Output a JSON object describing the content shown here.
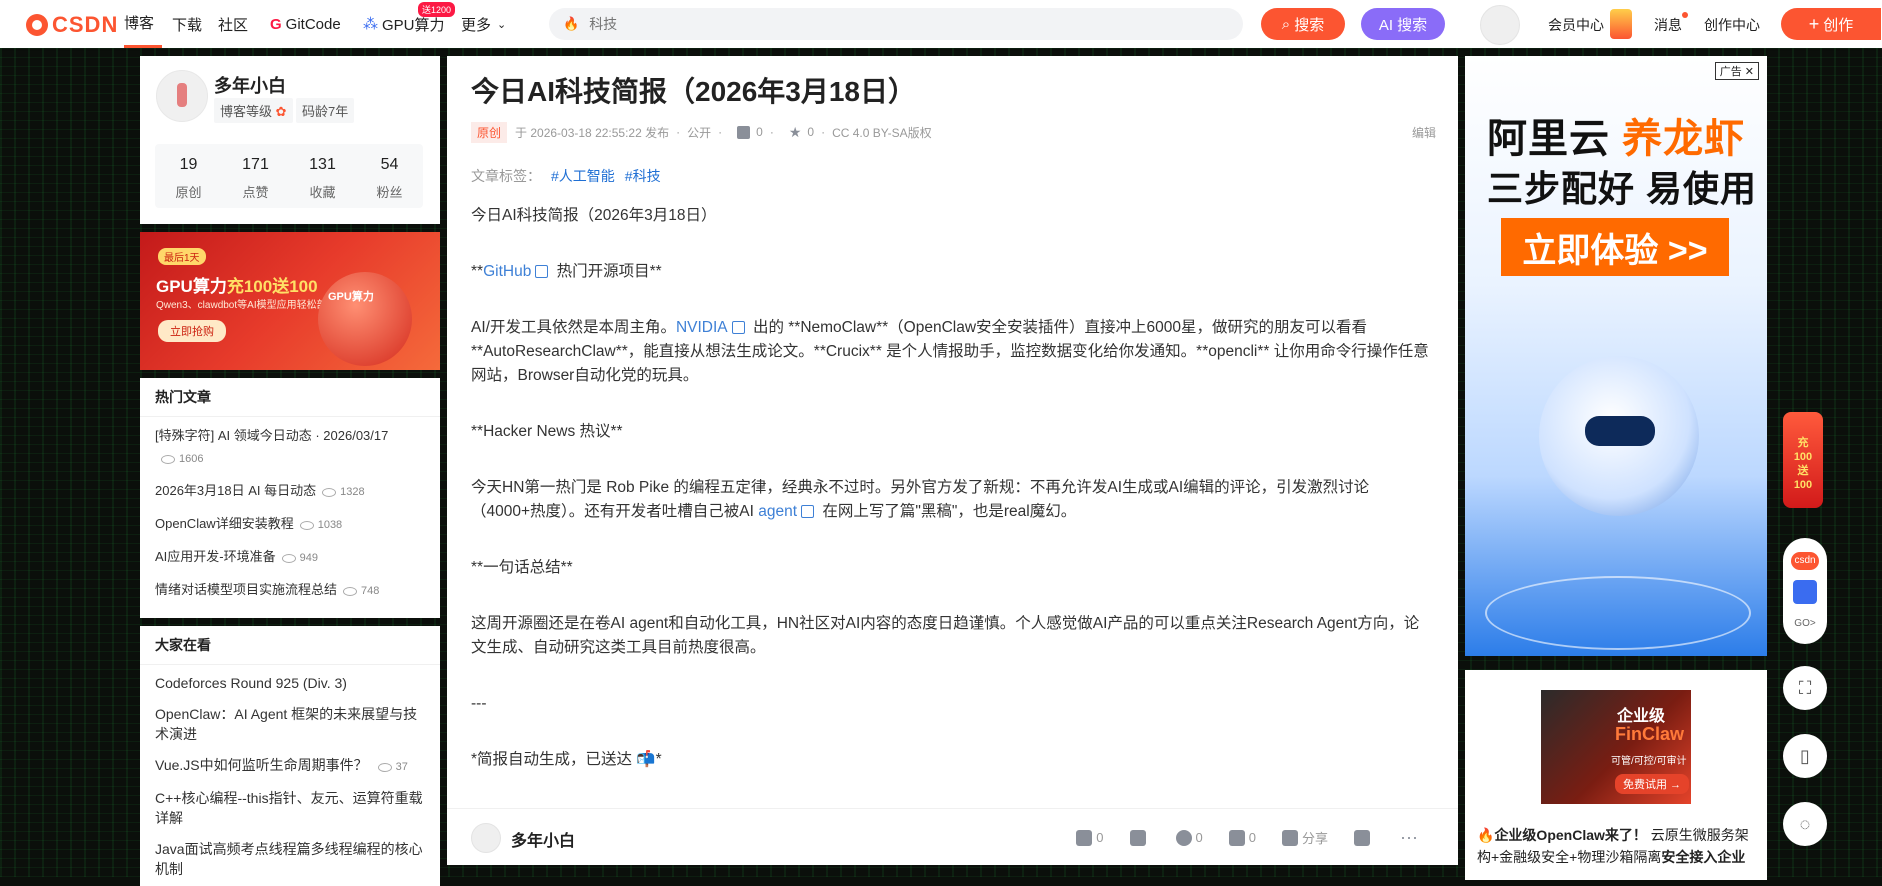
{
  "topbar": {
    "logo_text": "CSDN",
    "nav": [
      "博客",
      "下载",
      "社区",
      "GitCode",
      "GPU算力",
      "更多"
    ],
    "gpu_badge": "送1200",
    "search_placeholder": "科技",
    "search_button": "搜索",
    "ai_search_button": "AI 搜索",
    "vip_link": "会员中心",
    "messages_link": "消息",
    "creator_center_link": "创作中心",
    "create_button": "创作"
  },
  "profile": {
    "name": "多年小白",
    "level_label": "博客等级",
    "code_age": "码龄7年",
    "stats": [
      {
        "value": "19",
        "label": "原创"
      },
      {
        "value": "171",
        "label": "点赞"
      },
      {
        "value": "131",
        "label": "收藏"
      },
      {
        "value": "54",
        "label": "粉丝"
      }
    ]
  },
  "promo": {
    "badge": "最后1天",
    "title_prefix": "GPU算力",
    "title_highlight": "充100送100",
    "subtitle": "Qwen3、clawdbot等AI模型应用轻松部署",
    "button": "立即抢购",
    "ball_label": "GPU算力"
  },
  "hot_articles": {
    "title": "热门文章",
    "items": [
      {
        "title": "[特殊字符] AI 领域今日动态 · 2026/03/17",
        "views": "1606"
      },
      {
        "title": "2026年3月18日 AI 每日动态",
        "views": "1328"
      },
      {
        "title": "OpenClaw详细安装教程",
        "views": "1038"
      },
      {
        "title": "AI应用开发-环境准备",
        "views": "949"
      },
      {
        "title": "情绪对话模型项目实施流程总结",
        "views": "748"
      }
    ]
  },
  "everyone_watching": {
    "title": "大家在看",
    "items": [
      {
        "title": "Codeforces Round 925 (Div. 3)",
        "views": ""
      },
      {
        "title": "OpenClaw：AI Agent 框架的未来展望与技术演进",
        "views": ""
      },
      {
        "title": "Vue.JS中如何监听生命周期事件？",
        "views": "37"
      },
      {
        "title": "C++核心编程--this指针、友元、运算符重载详解",
        "views": ""
      },
      {
        "title": "Java面试高频考点线程篇多线程编程的核心机制",
        "views": ""
      }
    ]
  },
  "article": {
    "title": "今日AI科技简报（2026年3月18日）",
    "original_badge": "原创",
    "published": "于 2026-03-18 22:55:22 发布",
    "visibility": "公开",
    "likes": "0",
    "favorites": "0",
    "license": "CC 4.0 BY-SA版权",
    "edit": "编辑",
    "tags_label": "文章标签：",
    "tags": [
      "#人工智能",
      "#科技"
    ],
    "p_title": "今日AI科技简报（2026年3月18日）",
    "h_github_pre": "**",
    "h_github_link": "GitHub",
    "h_github_post": " 热门开源项目**",
    "p1_a": "AI/开发工具依然是本周主角。",
    "p1_link": "NVIDIA",
    "p1_b": " 出的 **NemoClaw**（OpenClaw安全安装插件）直接冲上6000星，做研究的朋友可以看看 **AutoResearchClaw**，能直接从想法生成论文。**Crucix** 是个人情报助手，监控数据变化给你发通知。**opencli** 让你用命令行操作任意网站，Browser自动化党的玩具。",
    "h_hn": "**Hacker News 热议**",
    "p2_a": "今天HN第一热门是 Rob Pike 的编程五定律，经典永不过时。另外官方发了新规：不再允许发AI生成或AI编辑的评论，引发激烈讨论（4000+热度）。还有开发者吐槽自己被AI ",
    "p2_link": "agent",
    "p2_b": " 在网上写了篇\"黑稿\"，也是real魔幻。",
    "h_summary": "**一句话总结**",
    "p3": "这周开源圈还是在卷AI agent和自动化工具，HN社区对AI内容的态度日趋谨慎。个人感觉做AI产品的可以重点关注Research Agent方向，论文生成、自动研究这类工具目前热度很高。",
    "hr": "---",
    "footer_note_a": "*简报自动生成，已送达 ",
    "footer_note_emoji": "📬",
    "footer_note_b": "*"
  },
  "article_footer": {
    "author": "多年小白",
    "like_count": "0",
    "favorite_count": "0",
    "comment_count": "0",
    "share_label": "分享"
  },
  "ad_main": {
    "tag": "广告",
    "line1_prefix": "阿里云 ",
    "line1_highlight": "养龙虾",
    "line2": "三步配好 易使用",
    "button": "立即体验 >>"
  },
  "ad_secondary": {
    "img_title": "企业级",
    "img_brand": "FinClaw",
    "img_sub": "可管/可控/可审计",
    "img_btn": "免费试用 →",
    "text_bold": "企业级OpenClaw来了！",
    "text_rest": "云原生微服务架构+金融级安全+物理沙箱隔离",
    "text_bold2": "安全接入企业"
  },
  "float_bar": {
    "promo_text": "充100送100",
    "logo_label": "csdn",
    "go_label": "GO>"
  },
  "colors": {
    "brand": "#fc5531",
    "ai": "#8a6cf8",
    "link": "#3e80d6",
    "tag": "#1f6fd4"
  }
}
